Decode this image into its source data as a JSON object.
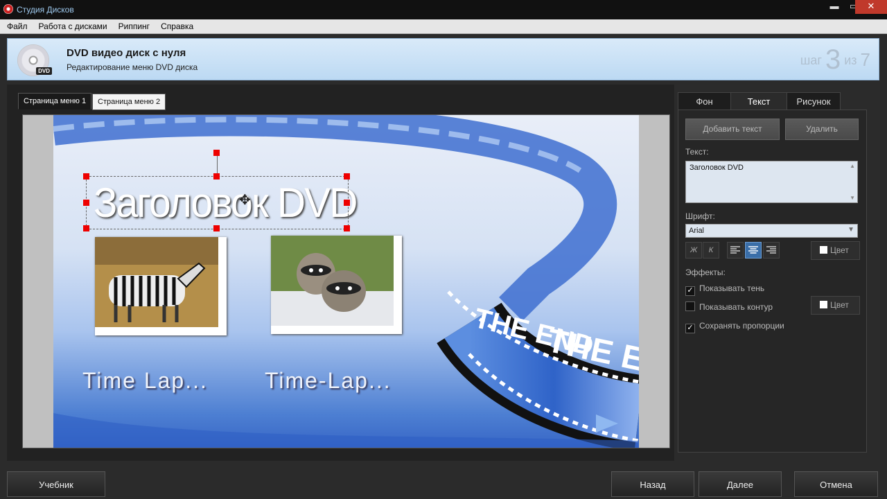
{
  "window": {
    "title": "Студия Дисков",
    "min": "▬",
    "max": "▭",
    "close": "✕"
  },
  "menu": [
    "Файл",
    "Работа с дисками",
    "Риппинг",
    "Справка"
  ],
  "header": {
    "title": "DVD видео диск с нуля",
    "subtitle": "Редактирование меню DVD диска",
    "disc_badge": "DVD",
    "step_prefix": "шаг",
    "step_number": "3",
    "step_of": "из",
    "step_total": "7"
  },
  "page_tabs": [
    "Страница меню 1",
    "Страница меню 2"
  ],
  "preview": {
    "heading": "Заголовок DVD",
    "captions": [
      "Time Lap...",
      "Time-Lap..."
    ],
    "film_text": "THE END"
  },
  "props_tabs": [
    "Фон",
    "Текст",
    "Рисунок"
  ],
  "text_panel": {
    "add_button": "Добавить текст",
    "delete_button": "Удалить",
    "text_label": "Текст:",
    "text_value": "Заголовок DVD",
    "font_label": "Шрифт:",
    "font_value": "Arial",
    "bold": "Ж",
    "italic": "К",
    "color_button": "Цвет",
    "effects_label": "Эффекты:",
    "effects": [
      {
        "label": "Показывать тень",
        "checked": true
      },
      {
        "label": "Показывать контур",
        "checked": false
      },
      {
        "label": "Сохранять пропорции",
        "checked": true
      }
    ],
    "outline_color_button": "Цвет"
  },
  "footer": {
    "tutorial": "Учебник",
    "back": "Назад",
    "next": "Далее",
    "cancel": "Отмена"
  }
}
